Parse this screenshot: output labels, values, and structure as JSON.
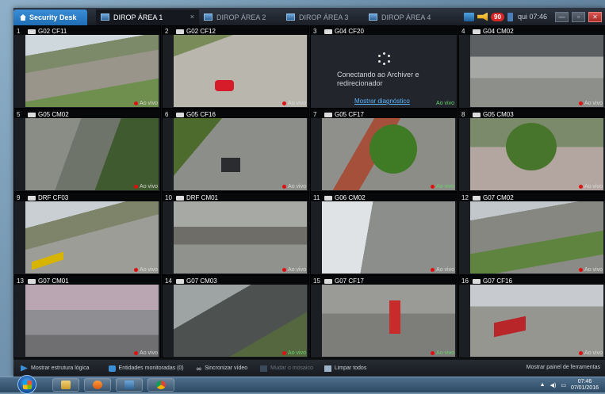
{
  "tabs": {
    "home": "Security Desk",
    "items": [
      {
        "label": "DIROP ÁREA 1",
        "active": true
      },
      {
        "label": "DIROP ÁREA 2",
        "active": false
      },
      {
        "label": "DIROP ÁREA 3",
        "active": false
      },
      {
        "label": "DIROP ÁREA 4",
        "active": false
      }
    ],
    "close_glyph": "×"
  },
  "tray": {
    "alarm_count": "90",
    "clock": "qui 07:46"
  },
  "tiles": [
    {
      "num": "1",
      "camera": "G02 CF11",
      "status": "Ao vivo"
    },
    {
      "num": "2",
      "camera": "G02 CF12",
      "status": "Ao vivo"
    },
    {
      "num": "3",
      "camera": "G04 CF20",
      "status": "Ao vivo",
      "connecting": true,
      "message": "Conectando ao Archiver e redirecionador",
      "diagnostic_link": "Mostrar diagnóstico"
    },
    {
      "num": "4",
      "camera": "G04 CM02",
      "status": "Ao vivo"
    },
    {
      "num": "5",
      "camera": "G05 CM02",
      "status": "Ao vivo"
    },
    {
      "num": "6",
      "camera": "G05 CF16",
      "status": "Ao vivo"
    },
    {
      "num": "7",
      "camera": "G05 CF17",
      "status": "Ao vivo"
    },
    {
      "num": "8",
      "camera": "G05 CM03",
      "status": "Ao vivo"
    },
    {
      "num": "9",
      "camera": "DRF CF03",
      "status": "Ao vivo"
    },
    {
      "num": "10",
      "camera": "DRF CM01",
      "status": "Ao vivo"
    },
    {
      "num": "11",
      "camera": "G06 CM02",
      "status": "Ao vivo"
    },
    {
      "num": "12",
      "camera": "G07 CM02",
      "status": "Ao vivo"
    },
    {
      "num": "13",
      "camera": "G07 CM01",
      "status": "Ao vivo"
    },
    {
      "num": "14",
      "camera": "G07 CM03",
      "status": "Ao vivo"
    },
    {
      "num": "15",
      "camera": "G07 CF17",
      "status": "Ao vivo"
    },
    {
      "num": "16",
      "camera": "G07 CF16",
      "status": "Ao vivo"
    }
  ],
  "toolbar": {
    "logical_view": "Mostrar estrutura lógica",
    "monitored": "Entidades monitoradas (0)",
    "sync_video": "Sincronizar vídeo",
    "change_mosaic": "Mudar o mosaico",
    "clear_all": "Limpar todos",
    "tools_panel": "Mostrar painel de ferramentas"
  },
  "taskbar": {
    "time": "07:46",
    "date": "07/01/2016"
  },
  "colors": {
    "accent": "#1f6db5",
    "live_dot": "#e01010",
    "alarm": "#d62626"
  }
}
